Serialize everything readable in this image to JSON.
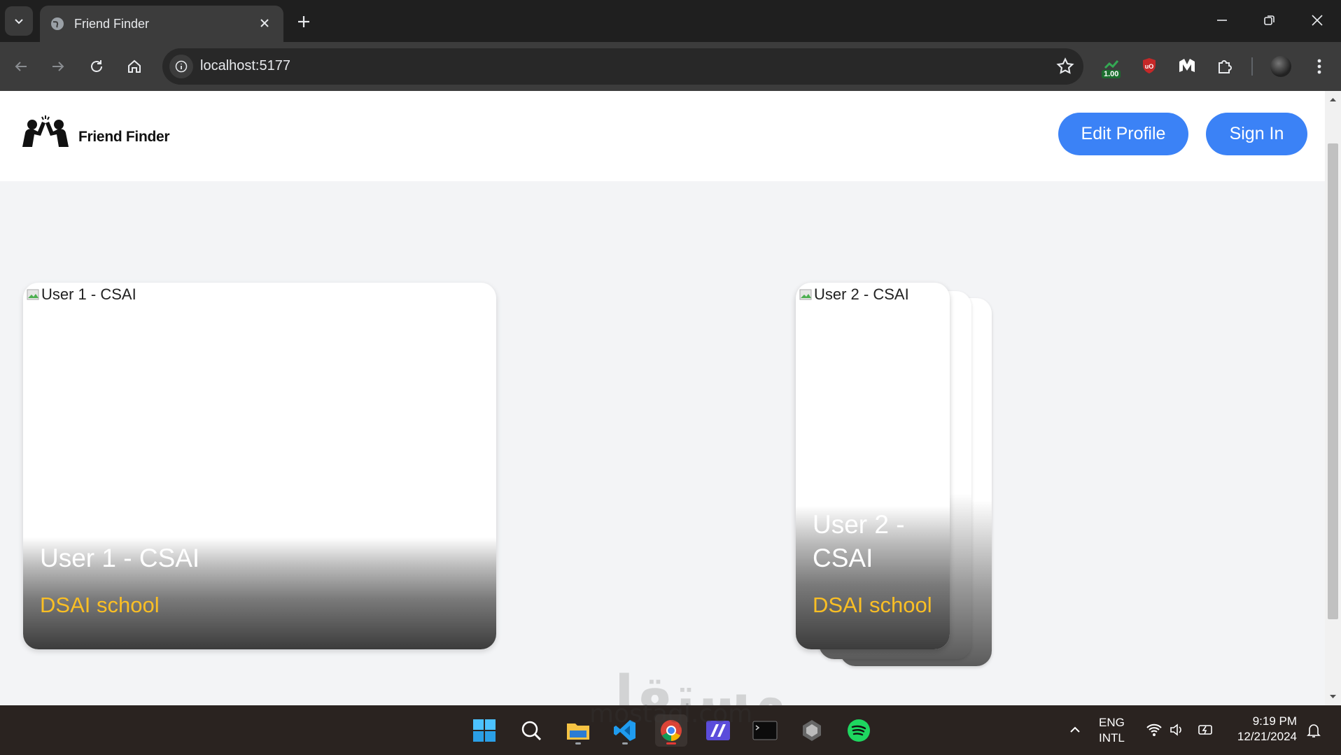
{
  "browser": {
    "tab_title": "Friend Finder",
    "url": "localhost:5177",
    "extension_badge": "1.00"
  },
  "app": {
    "logo_text": "Friend Finder",
    "edit_profile_label": "Edit Profile",
    "sign_in_label": "Sign In",
    "accent_color": "#3b82f6",
    "school_color": "#fbbf24"
  },
  "cards": [
    {
      "img_alt": "User 1 - CSAI",
      "name": "User 1 - CSAI",
      "school": "DSAI school"
    },
    {
      "img_alt": "User 2 - CSAI",
      "name": "User 2 - CSAI",
      "school": "DSAI school"
    }
  ],
  "watermark": {
    "text": "مستقل",
    "sub": "mostaql.com"
  },
  "taskbar": {
    "apps": [
      "windows-start-icon",
      "search-icon",
      "file-explorer-icon",
      "vscode-icon",
      "chrome-icon",
      "editor-icon",
      "terminal-icon",
      "unity-icon",
      "spotify-icon"
    ],
    "lang_line1": "ENG",
    "lang_line2": "INTL",
    "time": "9:19 PM",
    "date": "12/21/2024"
  }
}
